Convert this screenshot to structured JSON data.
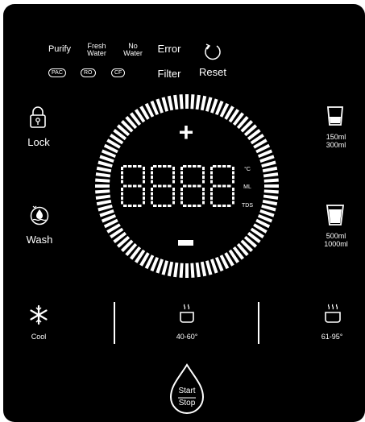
{
  "status_labels": {
    "purify": "Purify",
    "fresh_water": [
      "Fresh",
      "Water"
    ],
    "no_water": [
      "No",
      "Water"
    ],
    "error": "Error",
    "filter": "Filter",
    "reset": "Reset"
  },
  "filter_badges": [
    "PAC",
    "RO",
    "CF"
  ],
  "left_buttons": {
    "lock": "Lock",
    "wash": "Wash"
  },
  "right_buttons": {
    "small_cup": [
      "150ml",
      "300ml"
    ],
    "large_cup": [
      "500ml",
      "1000ml"
    ]
  },
  "dial": {
    "plus": "+",
    "minus": "−",
    "units": [
      "°C",
      "ML",
      "TDS"
    ],
    "digits": [
      "8",
      "8",
      "8",
      "8"
    ]
  },
  "temperature_buttons": {
    "cool": "Cool",
    "warm": "40-60°",
    "hot": "61-95°"
  },
  "start_stop": [
    "Start",
    "Stop"
  ]
}
